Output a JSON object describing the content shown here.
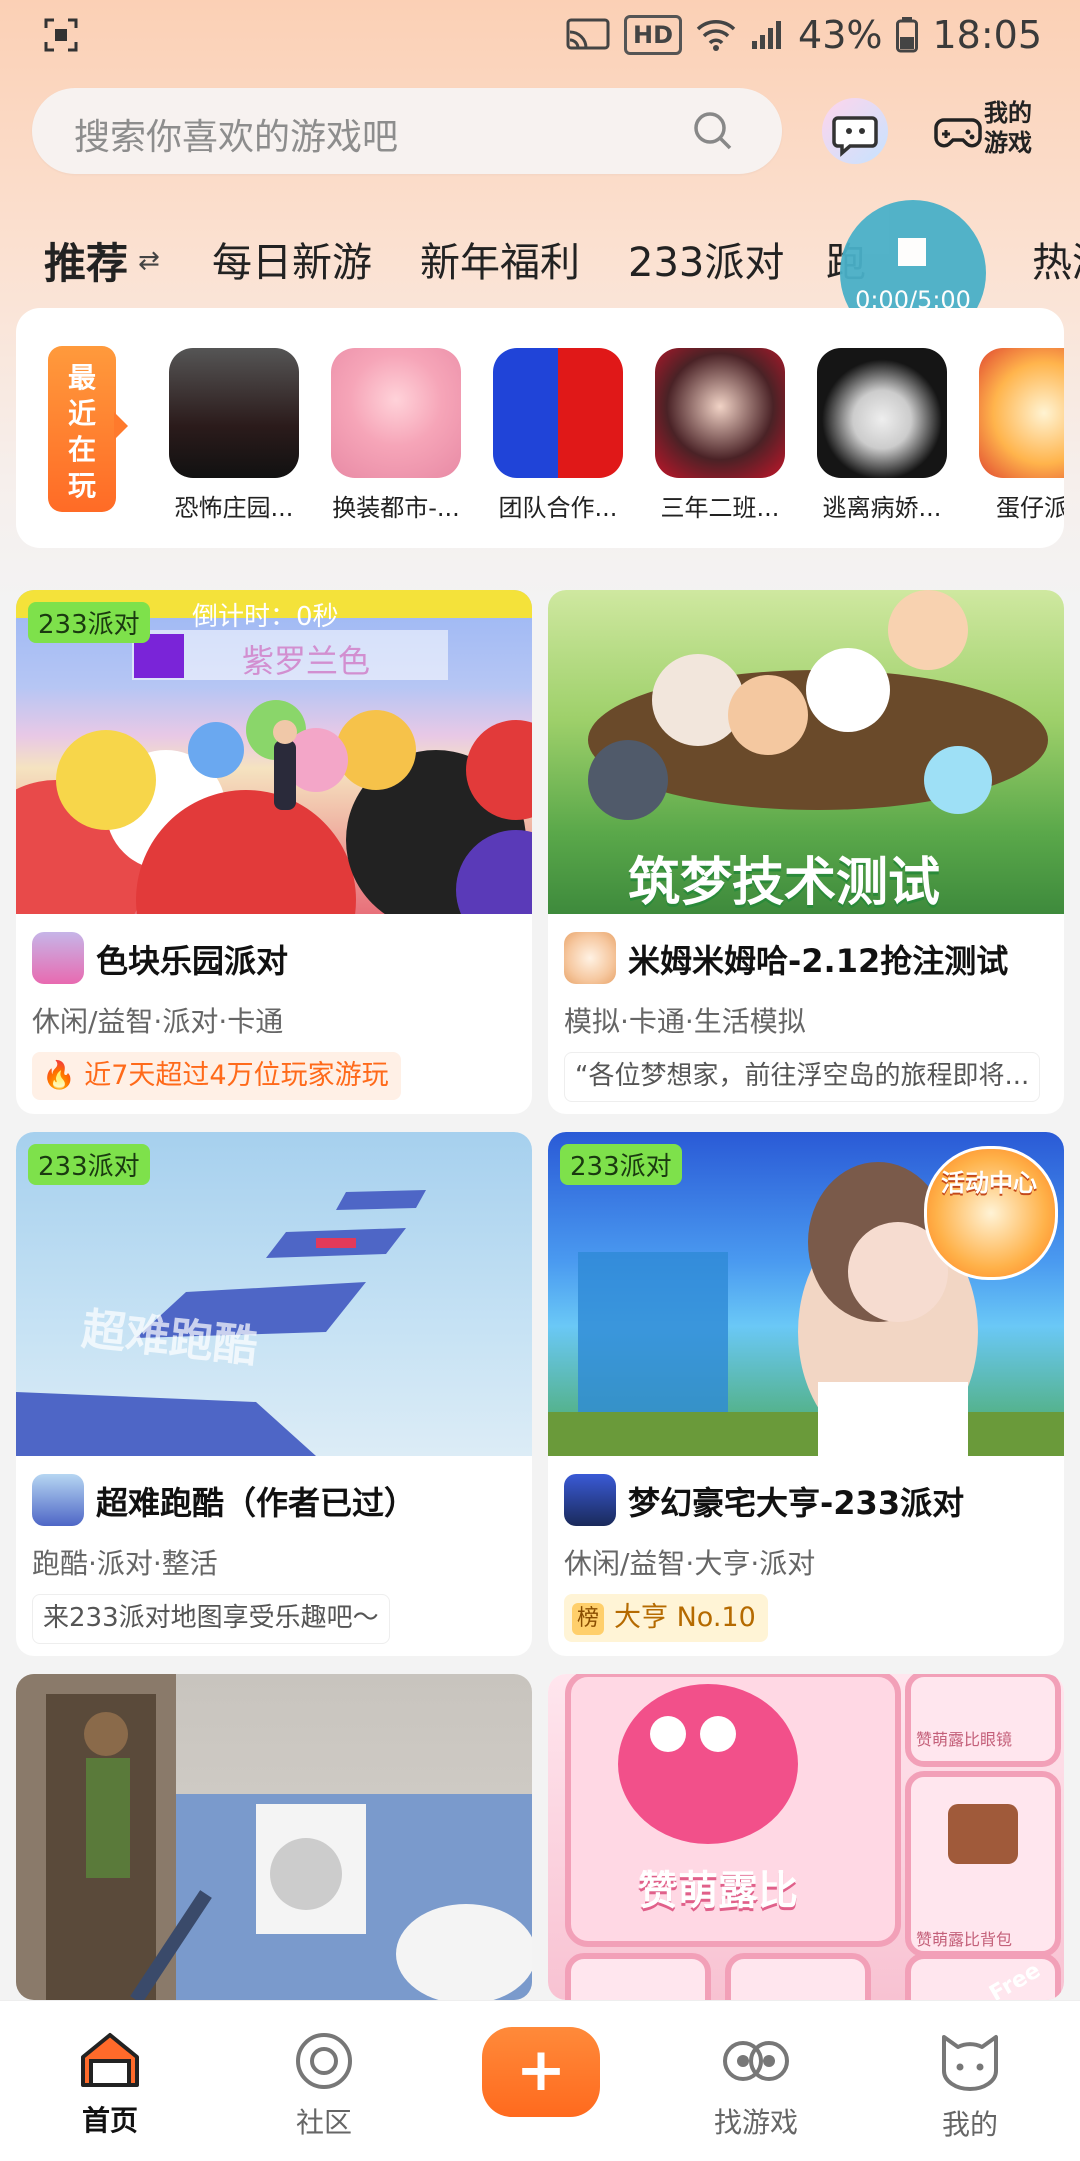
{
  "status": {
    "battery": "43%",
    "time": "18:05",
    "hd": "HD"
  },
  "search": {
    "placeholder": "搜索你喜欢的游戏吧"
  },
  "header": {
    "my_games_line1": "我的",
    "my_games_line2": "游戏"
  },
  "tabs": [
    {
      "label": "推荐"
    },
    {
      "label": "每日新游"
    },
    {
      "label": "新年福利"
    },
    {
      "label": "233派对"
    },
    {
      "label": "跑"
    },
    {
      "label": "热游"
    }
  ],
  "timer": {
    "text": "0:00/5:00"
  },
  "recent": {
    "badge": "最近在玩",
    "games": [
      {
        "name": "恐怖庄园..."
      },
      {
        "name": "换装都市-..."
      },
      {
        "name": "团队合作..."
      },
      {
        "name": "三年二班..."
      },
      {
        "name": "逃离病娇..."
      },
      {
        "name": "蛋仔派对"
      }
    ]
  },
  "cards": [
    {
      "tag": "233派对",
      "title": "色块乐园派对",
      "tags": "休闲/益智·派对·卡通",
      "hot": "近7天超过4万位玩家游玩",
      "banner1": "紫罗兰色",
      "banner2": "倒计时：0秒"
    },
    {
      "title": "米姆米姆哈-2.12抢注测试",
      "tags": "模拟·卡通·生活模拟",
      "desc": "“各位梦想家，前往浮空岛的旅程即将...",
      "banner": "筑梦技术测试"
    },
    {
      "tag": "233派对",
      "title": "超难跑酷（作者已过）",
      "tags": "跑酷·派对·整活",
      "desc": "来233派对地图享受乐趣吧〜",
      "banner": "超难跑酷"
    },
    {
      "tag": "233派对",
      "title": "梦幻豪宅大亨-233派对",
      "tags": "休闲/益智·大亨·派对",
      "rank_badge": "榜",
      "rank": "大亨 No.10",
      "banner": "活动中心"
    },
    {
      "title": "",
      "tags": ""
    },
    {
      "title": "",
      "tags": "",
      "banner": "赞萌露比",
      "side1": "赞萌露比眼镜",
      "side2": "赞萌露比背包",
      "free": "Free"
    }
  ],
  "nav": [
    {
      "label": "首页"
    },
    {
      "label": "社区"
    },
    {
      "label": "+"
    },
    {
      "label": "找游戏"
    },
    {
      "label": "我的"
    }
  ]
}
